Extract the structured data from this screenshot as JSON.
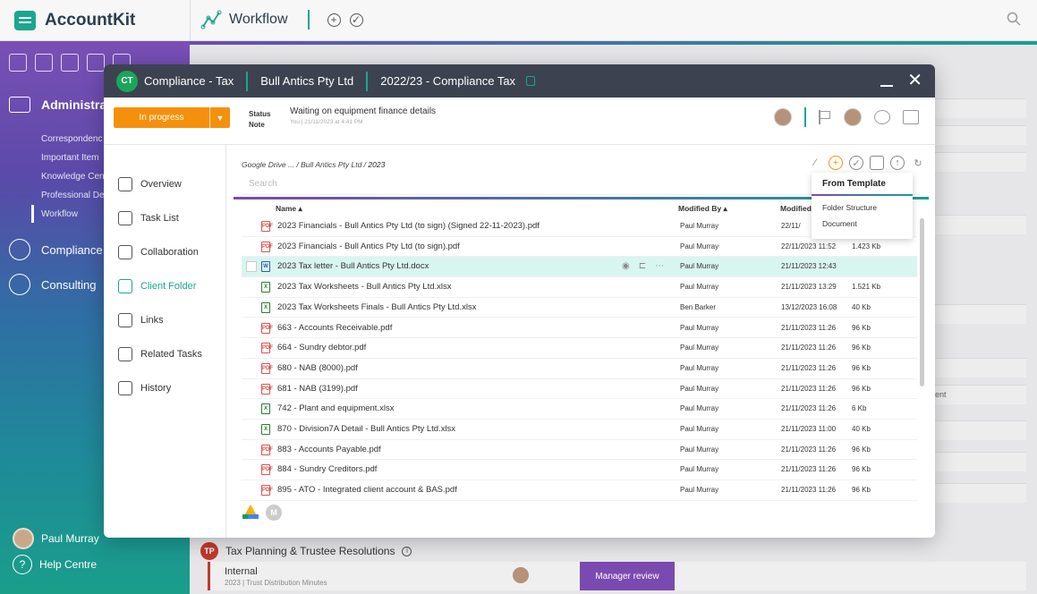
{
  "app": {
    "brand": "AccountKit",
    "page_title": "Workflow"
  },
  "sidebar": {
    "section_admin": "Administrati",
    "sub_items": [
      "Correspondenc",
      "Important Item",
      "Knowledge Cen",
      "Professional De",
      "Workflow"
    ],
    "sections": [
      "Compliance",
      "Consulting"
    ],
    "user": "Paul Murray",
    "help": "Help Centre"
  },
  "modal": {
    "badge": "CT",
    "title": "Compliance - Tax",
    "client": "Bull Antics Pty Ltd",
    "period": "2022/23 - Compliance Tax",
    "status_button": "In progress",
    "status_label": "Status",
    "note_label": "Note",
    "note_value": "Waiting on equipment finance details",
    "note_meta": "You | 21/11/2023 at 4:41 PM"
  },
  "nav": [
    {
      "label": "Overview",
      "icon": "home-icon"
    },
    {
      "label": "Task List",
      "icon": "checklist-icon"
    },
    {
      "label": "Collaboration",
      "icon": "chat-icon"
    },
    {
      "label": "Client Folder",
      "icon": "folder-icon",
      "active": true
    },
    {
      "label": "Links",
      "icon": "link-icon"
    },
    {
      "label": "Related Tasks",
      "icon": "related-icon"
    },
    {
      "label": "History",
      "icon": "history-icon"
    }
  ],
  "folder": {
    "breadcrumb_path": "Google Drive ... / Bull Antics Pty Ltd  /",
    "breadcrumb_current": "2023",
    "search_placeholder": "Search",
    "col_name": "Name ▴",
    "col_modified_by": "Modified By ▴",
    "col_modified": "Modified",
    "files": [
      {
        "name": "2023 Financials - Bull Antics Pty Ltd (to sign) (Signed 22-11-2023).pdf",
        "type": "pdf",
        "by": "Paul Murray",
        "modified": "22/11/",
        "size": ""
      },
      {
        "name": "2023 Financials - Bull Antics Pty Ltd (to sign).pdf",
        "type": "pdf",
        "by": "Paul Murray",
        "modified": "22/11/2023 11:52",
        "size": "1.423 Kb"
      },
      {
        "name": "2023 Tax letter - Bull Antics Pty Ltd.docx",
        "type": "docx",
        "by": "Paul Murray",
        "modified": "21/11/2023 12:43",
        "size": "",
        "selected": true
      },
      {
        "name": "2023 Tax Worksheets - Bull Antics Pty Ltd.xlsx",
        "type": "xlsx",
        "by": "Paul Murray",
        "modified": "21/11/2023 13:29",
        "size": "1.521 Kb"
      },
      {
        "name": "2023 Tax Worksheets Finals - Bull Antics Pty Ltd.xlsx",
        "type": "xlsx",
        "by": "Ben Barker",
        "modified": "13/12/2023 16:08",
        "size": "40 Kb"
      },
      {
        "name": "663 - Accounts Receivable.pdf",
        "type": "pdf",
        "by": "Paul Murray",
        "modified": "21/11/2023 11:26",
        "size": "96 Kb"
      },
      {
        "name": "664 - Sundry debtor.pdf",
        "type": "pdf",
        "by": "Paul Murray",
        "modified": "21/11/2023 11:26",
        "size": "96 Kb"
      },
      {
        "name": "680 - NAB (8000).pdf",
        "type": "pdf",
        "by": "Paul Murray",
        "modified": "21/11/2023 11:26",
        "size": "96 Kb"
      },
      {
        "name": "681 - NAB (3199).pdf",
        "type": "pdf",
        "by": "Paul Murray",
        "modified": "21/11/2023 11:26",
        "size": "96 Kb"
      },
      {
        "name": "742 - Plant and equipment.xlsx",
        "type": "xlsx",
        "by": "Paul Murray",
        "modified": "21/11/2023 11:26",
        "size": "6 Kb"
      },
      {
        "name": "870 - Division7A Detail - Bull Antics Pty Ltd.xlsx",
        "type": "xlsx",
        "by": "Paul Murray",
        "modified": "21/11/2023 11:00",
        "size": "40 Kb"
      },
      {
        "name": "883 - Accounts Payable.pdf",
        "type": "pdf",
        "by": "Paul Murray",
        "modified": "21/11/2023 11:26",
        "size": "96 Kb"
      },
      {
        "name": "884 - Sundry Creditors.pdf",
        "type": "pdf",
        "by": "Paul Murray",
        "modified": "21/11/2023 11:26",
        "size": "96 Kb"
      },
      {
        "name": "895 - ATO - Integrated client account & BAS.pdf",
        "type": "pdf",
        "by": "Paul Murray",
        "modified": "21/11/2023 11:26",
        "size": "96 Kb"
      }
    ]
  },
  "template_menu": {
    "title": "From Template",
    "items": [
      "Folder Structure",
      "Document"
    ]
  },
  "background": {
    "tp_badge": "TP",
    "tp_title": "Tax Planning & Trustee Resolutions",
    "internal_title": "Internal",
    "internal_sub": "2023 | Trust Distribution Minutes",
    "manager_review": "Manager review",
    "side_fragment": "ent"
  },
  "colors": {
    "accent": "#1aa68f",
    "status_orange": "#f5900c",
    "header_dark": "#3d4250",
    "purple": "#7b4ab0"
  }
}
